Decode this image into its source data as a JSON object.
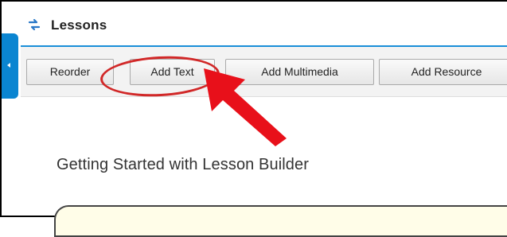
{
  "header": {
    "title": "Lessons",
    "icon": "refresh-arrows-icon"
  },
  "side_tab": {
    "icon": "chevron-left-icon",
    "color": "#0a85d1"
  },
  "toolbar": {
    "buttons": [
      {
        "label": "Reorder"
      },
      {
        "label": "Add Text"
      },
      {
        "label": "Add Multimedia"
      },
      {
        "label": "Add Resource"
      }
    ]
  },
  "annotation": {
    "highlight_color": "#d12828",
    "arrow_color": "#e8101a",
    "highlighted": "Add Text"
  },
  "main": {
    "heading": "Getting Started with Lesson Builder"
  }
}
